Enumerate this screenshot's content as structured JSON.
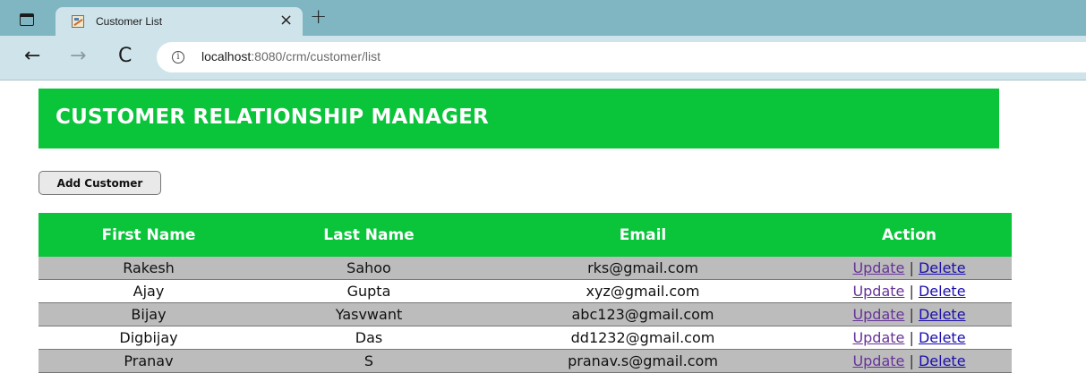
{
  "browser": {
    "tab_title": "Customer List",
    "close_glyph": "×",
    "new_tab_glyph": "+",
    "back_glyph": "←",
    "forward_glyph": "→",
    "reload_glyph": "C",
    "info_glyph": "i",
    "url_host": "localhost",
    "url_rest": ":8080/crm/customer/list"
  },
  "page": {
    "title": "CUSTOMER RELATIONSHIP MANAGER",
    "add_button": "Add Customer",
    "accent_color": "#0ac43a"
  },
  "table": {
    "headers": [
      "First Name",
      "Last Name",
      "Email",
      "Action"
    ],
    "update_label": "Update",
    "delete_label": "Delete",
    "separator": "|",
    "rows": [
      {
        "first": "Rakesh",
        "last": "Sahoo",
        "email": "rks@gmail.com"
      },
      {
        "first": "Ajay",
        "last": "Gupta",
        "email": "xyz@gmail.com"
      },
      {
        "first": "Bijay",
        "last": "Yasvwant",
        "email": "abc123@gmail.com"
      },
      {
        "first": "Digbijay",
        "last": "Das",
        "email": "dd1232@gmail.com"
      },
      {
        "first": "Pranav",
        "last": "S",
        "email": "pranav.s@gmail.com"
      }
    ]
  }
}
